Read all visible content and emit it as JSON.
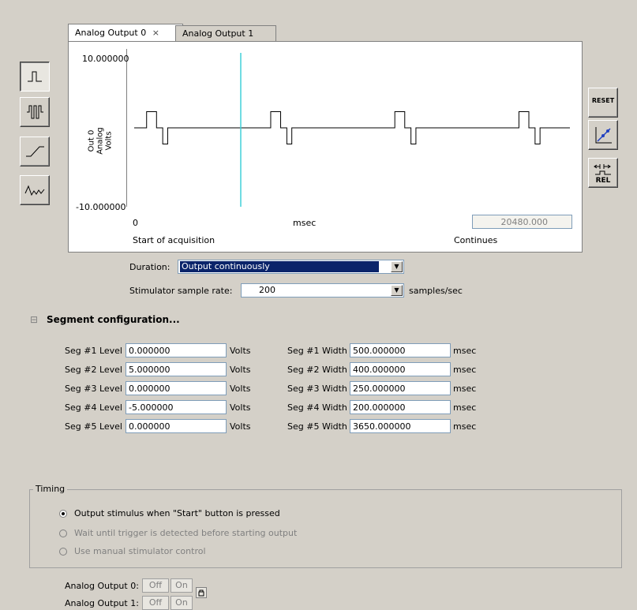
{
  "tabs": [
    {
      "label": "Analog Output 0",
      "close": "×"
    },
    {
      "label": "Analog Output 1"
    }
  ],
  "plot": {
    "y_max": "10.000000",
    "y_min": "-10.000000",
    "y_label_line1": "Out 0",
    "y_label_line2": "Analog",
    "y_label_line3": "Volts",
    "x_start": "0",
    "x_unit": "msec",
    "x_end": "20480.000",
    "start_caption": "Start of acquisition",
    "end_caption": "Continues"
  },
  "chart_data": {
    "type": "line",
    "series": [
      {
        "name": "Out 0",
        "values": [
          0,
          5,
          0,
          -5,
          0
        ]
      }
    ],
    "segment_widths_msec": [
      500,
      400,
      250,
      200,
      3650
    ],
    "ylim": [
      -10,
      10
    ],
    "xlim": [
      0,
      20480
    ],
    "cursor_x": 5000
  },
  "waveform_buttons": [
    "pulse-icon",
    "pulse-train-icon",
    "ramp-icon",
    "arbitrary-wave-icon"
  ],
  "right_buttons": {
    "reset": "RESET",
    "rel": "REL",
    "scale_icon": "autoscale-icon",
    "rel_icon": "relative-step-icon"
  },
  "duration": {
    "label": "Duration:",
    "value": "Output continuously"
  },
  "sample_rate": {
    "label": "Stimulator sample rate:",
    "value": "200",
    "unit": "samples/sec"
  },
  "segment_section": {
    "title": "Segment configuration...",
    "expander": "⊟"
  },
  "segments": [
    {
      "level_label": "Seg #1 Level",
      "level": "0.000000",
      "level_unit": "Volts",
      "width_label": "Seg #1 Width",
      "width": "500.000000",
      "width_unit": "msec"
    },
    {
      "level_label": "Seg #2 Level",
      "level": "5.000000",
      "level_unit": "Volts",
      "width_label": "Seg #2 Width",
      "width": "400.000000",
      "width_unit": "msec"
    },
    {
      "level_label": "Seg #3 Level",
      "level": "0.000000",
      "level_unit": "Volts",
      "width_label": "Seg #3 Width",
      "width": "250.000000",
      "width_unit": "msec"
    },
    {
      "level_label": "Seg #4 Level",
      "level": "-5.000000",
      "level_unit": "Volts",
      "width_label": "Seg #4 Width",
      "width": "200.000000",
      "width_unit": "msec"
    },
    {
      "level_label": "Seg #5 Level",
      "level": "0.000000",
      "level_unit": "Volts",
      "width_label": "Seg #5 Width",
      "width": "3650.000000",
      "width_unit": "msec"
    }
  ],
  "timing": {
    "title": "Timing",
    "options": [
      {
        "label": "Output stimulus when \"Start\" button is pressed",
        "selected": true,
        "enabled": true
      },
      {
        "label": "Wait until trigger is detected before starting output",
        "selected": false,
        "enabled": false
      },
      {
        "label": "Use manual stimulator control",
        "selected": false,
        "enabled": false
      }
    ]
  },
  "outputs": [
    {
      "label": "Analog Output 0:",
      "off": "Off",
      "on": "On"
    },
    {
      "label": "Analog Output 1:",
      "off": "Off",
      "on": "On"
    }
  ],
  "colors": {
    "cursor": "#40d0d8",
    "selection": "#0a246a"
  }
}
